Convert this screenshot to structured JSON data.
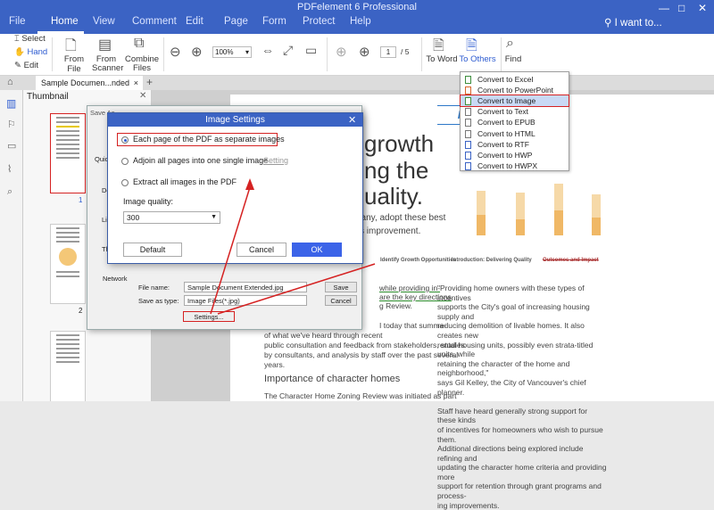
{
  "app": {
    "title": "PDFelement 6 Professional",
    "help_search": "I want to..."
  },
  "menu": [
    "File",
    "Home",
    "View",
    "Comment",
    "Edit",
    "Page",
    "Form",
    "Protect",
    "Help"
  ],
  "ribbon": {
    "select": "Select",
    "hand": "Hand",
    "edit": "Edit",
    "from_file": "From File",
    "from_scanner_1": "From",
    "from_scanner_2": "Scanner",
    "combine_1": "Combine",
    "combine_2": "Files",
    "zoom": "100%",
    "page_current": "1",
    "page_total": "/ 5",
    "to_word": "To Word",
    "to_others": "To Others",
    "find": "Find"
  },
  "tab": {
    "doc_name": "Sample Documen...nded",
    "close": "×",
    "add": "+"
  },
  "thumbnail": {
    "title": "Thumbnail",
    "page1": "1",
    "page2": "2"
  },
  "convert_menu": [
    {
      "label": "Convert to Excel",
      "color": "#3e8e3e"
    },
    {
      "label": "Convert to PowerPoint",
      "color": "#d5652c"
    },
    {
      "label": "Convert to Image",
      "color": "#3e8e3e"
    },
    {
      "label": "Convert to Text",
      "color": "#777777"
    },
    {
      "label": "Convert to EPUB",
      "color": "#777777"
    },
    {
      "label": "Convert to HTML",
      "color": "#777777"
    },
    {
      "label": "Convert to RTF",
      "color": "#3b63c4"
    },
    {
      "label": "Convert to HWP",
      "color": "#3b63c4"
    },
    {
      "label": "Convert to HWPX",
      "color": "#3b63c4"
    }
  ],
  "document": {
    "heading1": "growth",
    "heading2": "ng the",
    "heading3": "uality.",
    "banner": "NESS",
    "line1": "pany, adopt these best",
    "line2": "s improvement.",
    "tag1": "Identify Growth Opportunities",
    "tag2": "Introduction: Delivering Quality",
    "tag3": "Outcomes and Impact",
    "left_p1": "while providing in-",
    "left_p2": "are the key directions",
    "left_p3": "g Review.",
    "left_p4": "I today that summa-",
    "left_p5": "of what we've heard through recent",
    "left_p6": "public consultation and feedback from stakeholders, studies",
    "left_p7": "by consultants, and analysis by staff over the past several",
    "left_p8": "years.",
    "subheading": "Importance of character homes",
    "left_p9": "The Character Home Zoning Review was initiated as part",
    "right_p": [
      "\"Providing home owners with these types of incentives",
      "supports the City's goal of increasing housing supply and",
      "reducing demolition of livable homes. It also creates new",
      "rental housing units, possibly even strata-titled units, while",
      "retaining the character of the home and neighborhood,\"",
      "says Gil Kelley, the City of Vancouver's chief planner.",
      "",
      "Staff have heard generally strong support for these kinds",
      "of incentives for homeowners who wish to pursue them.",
      "Additional directions being explored include refining and",
      "updating the character home criteria and providing more",
      "support for retention through grant programs and process-",
      "ing improvements."
    ]
  },
  "save_as": {
    "title": "Save As",
    "side": [
      "Quick",
      "De",
      "Lib",
      "Th",
      "Network"
    ],
    "file_name_label": "File name:",
    "file_name_value": "Sample Document Extended.jpg",
    "type_label": "Save as type:",
    "type_value": "Image Files(*.jpg)",
    "save_btn": "Save",
    "cancel_btn": "Cancel",
    "settings_btn": "Settings..."
  },
  "image_settings": {
    "title": "Image Settings",
    "opt1": "Each page of the PDF as separate images",
    "opt2": "Adjoin all pages into one single image",
    "opt2_link": "Setting",
    "opt3": "Extract all images in the PDF",
    "quality_label": "Image quality:",
    "quality_value": "300",
    "default_btn": "Default",
    "cancel_btn": "Cancel",
    "ok_btn": "OK",
    "selected_option": 1
  },
  "colors": {
    "accent": "#3b63c4",
    "highlight": "#d52222",
    "chart": "#f6d9a8",
    "chart_dark": "#f0b866"
  }
}
